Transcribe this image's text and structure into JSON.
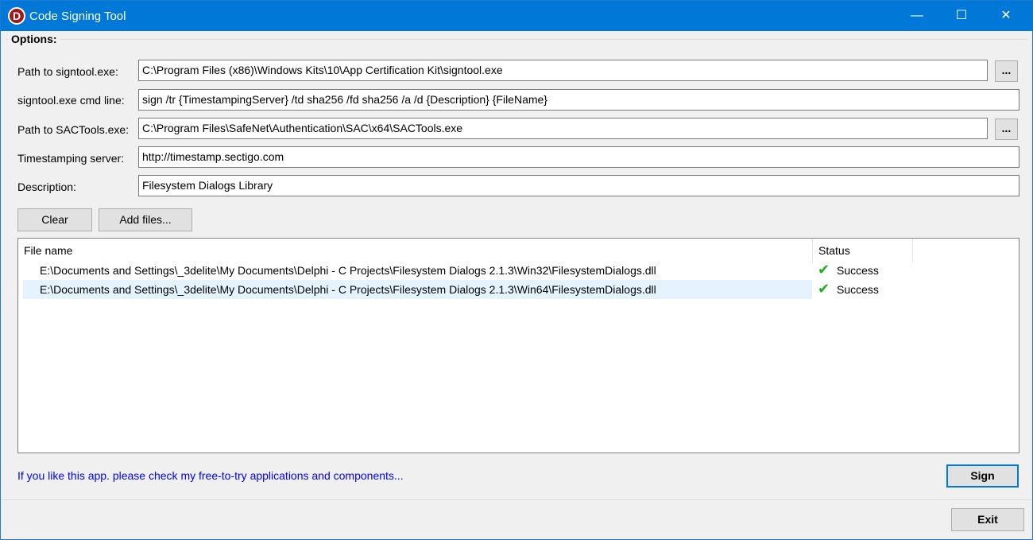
{
  "window": {
    "title": "Code Signing Tool",
    "app_icon_letter": "D",
    "minimize": "—",
    "maximize": "☐",
    "close": "✕"
  },
  "options": {
    "group_label": "Options:",
    "signtool_path_label": "Path to signtool.exe:",
    "signtool_path_value": "C:\\Program Files (x86)\\Windows Kits\\10\\App Certification Kit\\signtool.exe",
    "cmd_line_label": "signtool.exe cmd line:",
    "cmd_line_value": "sign /tr {TimestampingServer} /td sha256 /fd sha256 /a /d {Description} {FileName}",
    "sactools_path_label": "Path to SACTools.exe:",
    "sactools_path_value": "C:\\Program Files\\SafeNet\\Authentication\\SAC\\x64\\SACTools.exe",
    "timestamp_label": "Timestamping server:",
    "timestamp_value": "http://timestamp.sectigo.com",
    "description_label": "Description:",
    "description_value": "Filesystem Dialogs Library",
    "browse_label": "..."
  },
  "toolbar": {
    "clear_label": "Clear",
    "add_files_label": "Add files..."
  },
  "files": {
    "columns": [
      "File name",
      "Status"
    ],
    "rows": [
      {
        "name": "E:\\Documents and Settings\\_3delite\\My Documents\\Delphi - C Projects\\Filesystem Dialogs 2.1.3\\Win32\\FilesystemDialogs.dll",
        "status": "Success",
        "icon": "check-icon"
      },
      {
        "name": "E:\\Documents and Settings\\_3delite\\My Documents\\Delphi - C Projects\\Filesystem Dialogs 2.1.3\\Win64\\FilesystemDialogs.dll",
        "status": "Success",
        "icon": "check-icon"
      }
    ]
  },
  "check_glyph": "✔",
  "footer": {
    "link_text": "If you like this app. please check my free-to-try applications and components...",
    "sign_label": "Sign",
    "exit_label": "Exit"
  }
}
